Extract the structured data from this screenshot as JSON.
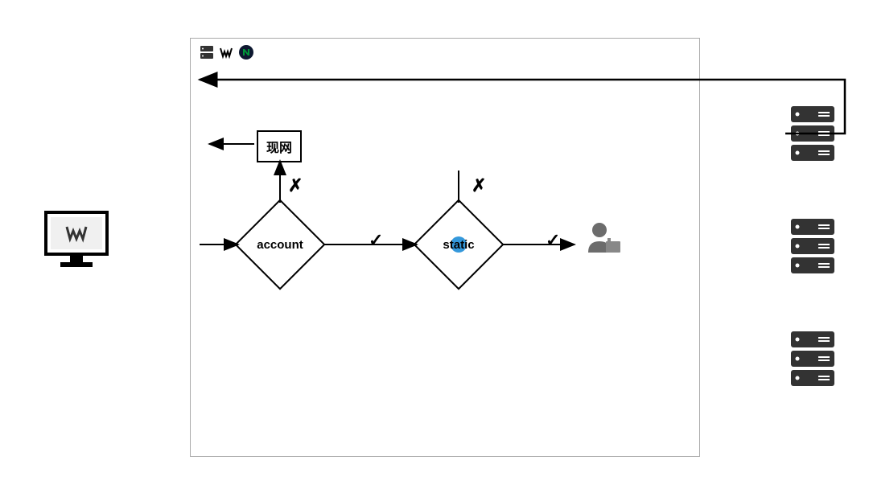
{
  "diagram": {
    "prod_label": "现网",
    "decision1": "account",
    "decision2": "static",
    "check1": "✓",
    "check2": "✓",
    "cross1": "✗",
    "cross2": "✗"
  }
}
